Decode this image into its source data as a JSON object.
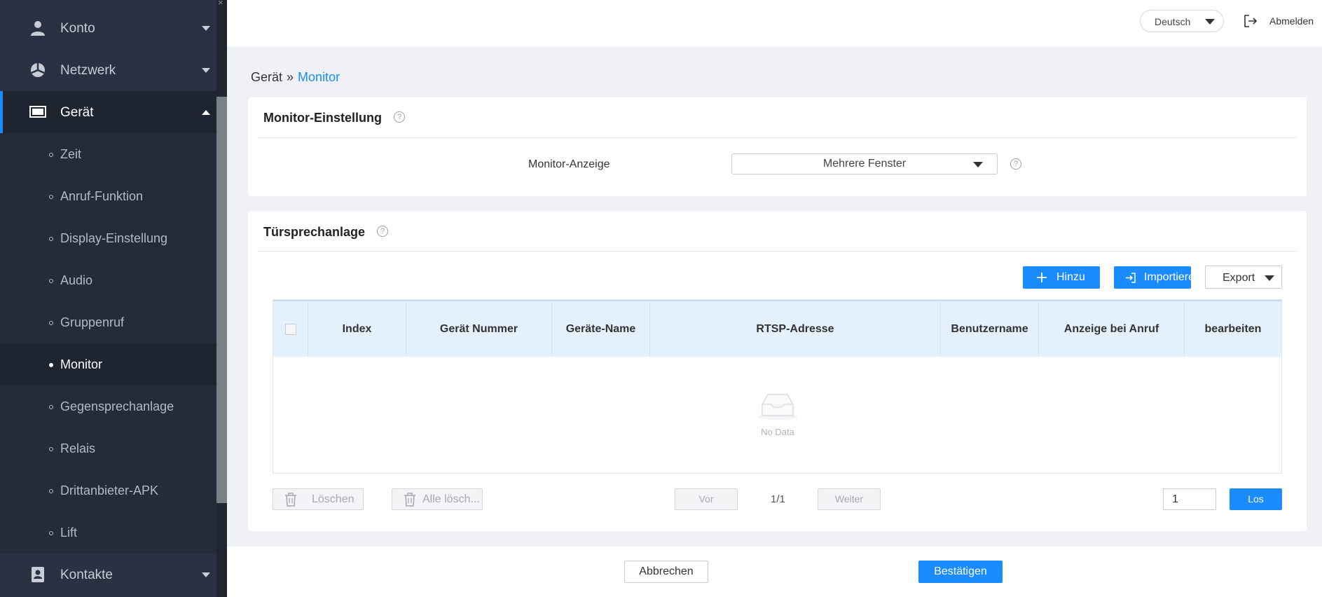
{
  "sidebar": {
    "items": [
      {
        "label": "Konto",
        "icon": "user-icon"
      },
      {
        "label": "Netzwerk",
        "icon": "network-icon"
      },
      {
        "label": "Gerät",
        "icon": "monitor-icon"
      }
    ],
    "sub_items": [
      {
        "label": "Zeit"
      },
      {
        "label": "Anruf-Funktion"
      },
      {
        "label": "Display-Einstellung"
      },
      {
        "label": "Audio"
      },
      {
        "label": "Gruppenruf"
      },
      {
        "label": "Monitor"
      },
      {
        "label": "Gegensprechanlage"
      },
      {
        "label": "Relais"
      },
      {
        "label": "Drittanbieter-APK"
      },
      {
        "label": "Lift"
      }
    ],
    "bottom_item": {
      "label": "Kontakte",
      "icon": "contacts-icon"
    },
    "scroll_close": "×"
  },
  "topbar": {
    "language": "Deutsch",
    "logout_label": "Abmelden"
  },
  "breadcrumb": {
    "parent": "Gerät",
    "separator": "»",
    "current": "Monitor"
  },
  "monitor_settings": {
    "title": "Monitor-Einstellung",
    "field_label": "Monitor-Anzeige",
    "field_value": "Mehrere Fenster",
    "help": "?"
  },
  "intercom": {
    "title": "Türsprechanlage",
    "help": "?",
    "add_label": "Hinzu",
    "import_label": "Importiere",
    "export_label": "Export",
    "columns": [
      "Index",
      "Gerät Nummer",
      "Geräte-Name",
      "RTSP-Adresse",
      "Benutzername",
      "Anzeige bei Anruf",
      "bearbeiten"
    ],
    "empty_text": "No Data",
    "delete_label": "Löschen",
    "delete_all_label": "Alle lösch...",
    "prev_label": "Vor",
    "page_indicator": "1/1",
    "next_label": "Weiter",
    "page_input": "1",
    "go_label": "Los"
  },
  "footer": {
    "cancel_label": "Abbrechen",
    "confirm_label": "Bestätigen"
  },
  "colors": {
    "accent": "#1a8cff",
    "sidebar_bg": "#2a3142"
  }
}
